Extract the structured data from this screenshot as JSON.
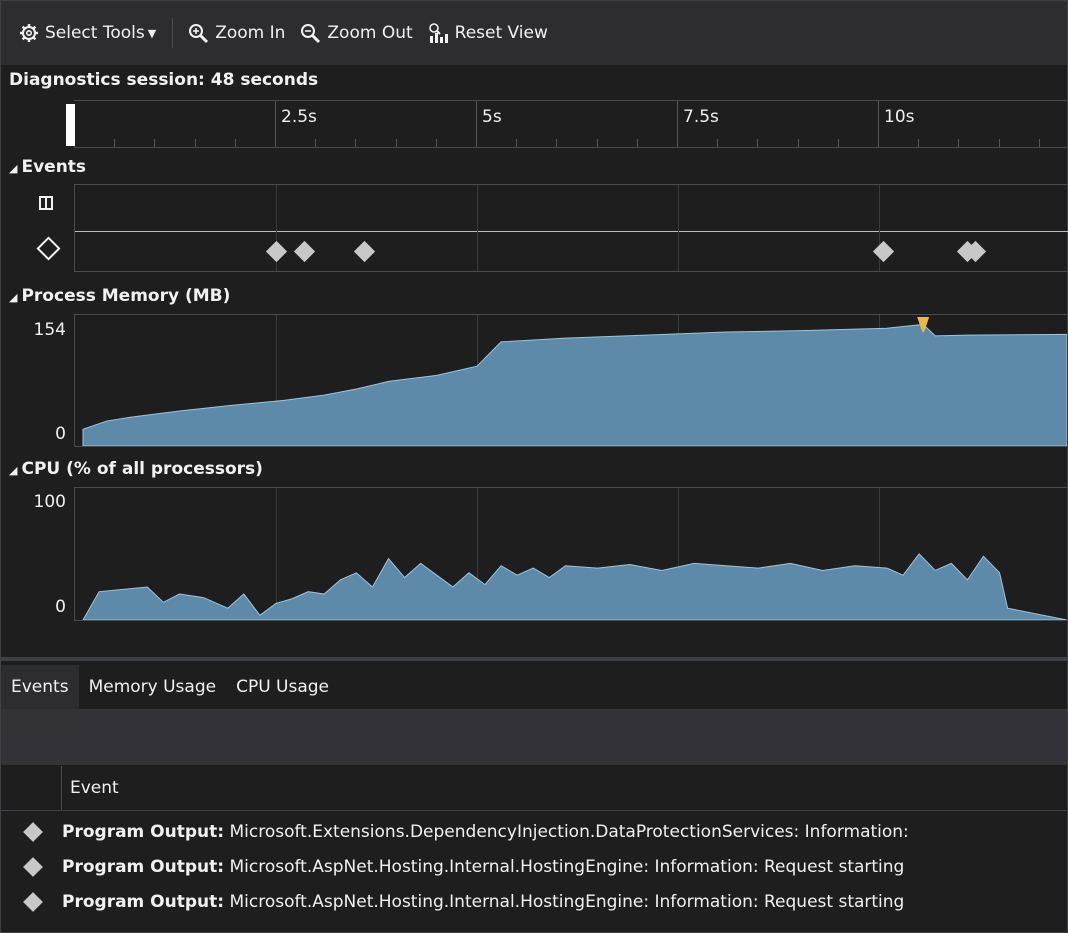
{
  "toolbar": {
    "select_tools": "Select Tools",
    "zoom_in": "Zoom In",
    "zoom_out": "Zoom Out",
    "reset_view": "Reset View"
  },
  "session_label": "Diagnostics session: 48 seconds",
  "ruler": {
    "ticks": [
      "2.5s",
      "5s",
      "7.5s",
      "10s"
    ]
  },
  "sections": {
    "events": "Events",
    "memory": "Process Memory (MB)",
    "cpu": "CPU (% of all processors)"
  },
  "memory_axis": {
    "max": "154",
    "min": "0"
  },
  "cpu_axis": {
    "max": "100",
    "min": "0"
  },
  "tabs": [
    "Events",
    "Memory Usage",
    "CPU Usage"
  ],
  "table": {
    "column": "Event",
    "rows": [
      {
        "kind": "Program Output:",
        "text": "Microsoft.Extensions.DependencyInjection.DataProtectionServices: Information:"
      },
      {
        "kind": "Program Output:",
        "text": "Microsoft.AspNet.Hosting.Internal.HostingEngine: Information: Request starting"
      },
      {
        "kind": "Program Output:",
        "text": "Microsoft.AspNet.Hosting.Internal.HostingEngine: Information: Request starting"
      }
    ]
  },
  "colors": {
    "accent_fill": "#5d8aa8",
    "marker": "#e8b84a",
    "diamond": "#c8c8c8"
  },
  "chart_data": [
    {
      "type": "scatter",
      "title": "Events",
      "x": [
        2.5,
        2.85,
        3.6,
        10.05,
        11.1,
        11.2
      ],
      "xlim": [
        0,
        12.3
      ]
    },
    {
      "type": "area",
      "title": "Process Memory (MB)",
      "x": [
        0,
        0.3,
        0.6,
        1.2,
        1.8,
        2.5,
        3.0,
        3.4,
        3.8,
        4.4,
        4.9,
        5.2,
        6.0,
        7.0,
        8.0,
        9.0,
        10.0,
        10.45,
        10.6,
        11.0,
        12.3
      ],
      "y": [
        22,
        33,
        38,
        46,
        53,
        60,
        67,
        75,
        85,
        93,
        105,
        137,
        142,
        146,
        150,
        152,
        155,
        160,
        145,
        146,
        147
      ],
      "ylim": [
        0,
        154
      ],
      "xlim": [
        0,
        12.3
      ]
    },
    {
      "type": "area",
      "title": "CPU (% of all processors)",
      "x": [
        0,
        0.2,
        0.5,
        0.8,
        1.0,
        1.2,
        1.5,
        1.8,
        2.0,
        2.2,
        2.4,
        2.6,
        2.8,
        3.0,
        3.2,
        3.4,
        3.6,
        3.8,
        4.0,
        4.2,
        4.4,
        4.6,
        4.8,
        5.0,
        5.2,
        5.4,
        5.6,
        5.8,
        6.0,
        6.4,
        6.8,
        7.2,
        7.6,
        8.0,
        8.4,
        8.8,
        9.2,
        9.6,
        10.0,
        10.2,
        10.4,
        10.6,
        10.8,
        11.0,
        11.2,
        11.4,
        11.5,
        12.3
      ],
      "y": [
        0,
        24,
        26,
        28,
        15,
        22,
        19,
        10,
        22,
        4,
        14,
        18,
        24,
        22,
        34,
        40,
        28,
        52,
        36,
        48,
        38,
        28,
        40,
        30,
        46,
        38,
        44,
        36,
        46,
        44,
        47,
        42,
        48,
        46,
        44,
        48,
        42,
        46,
        44,
        38,
        56,
        42,
        48,
        34,
        54,
        40,
        10,
        0
      ],
      "ylim": [
        0,
        100
      ],
      "xlim": [
        0,
        12.3
      ]
    }
  ]
}
